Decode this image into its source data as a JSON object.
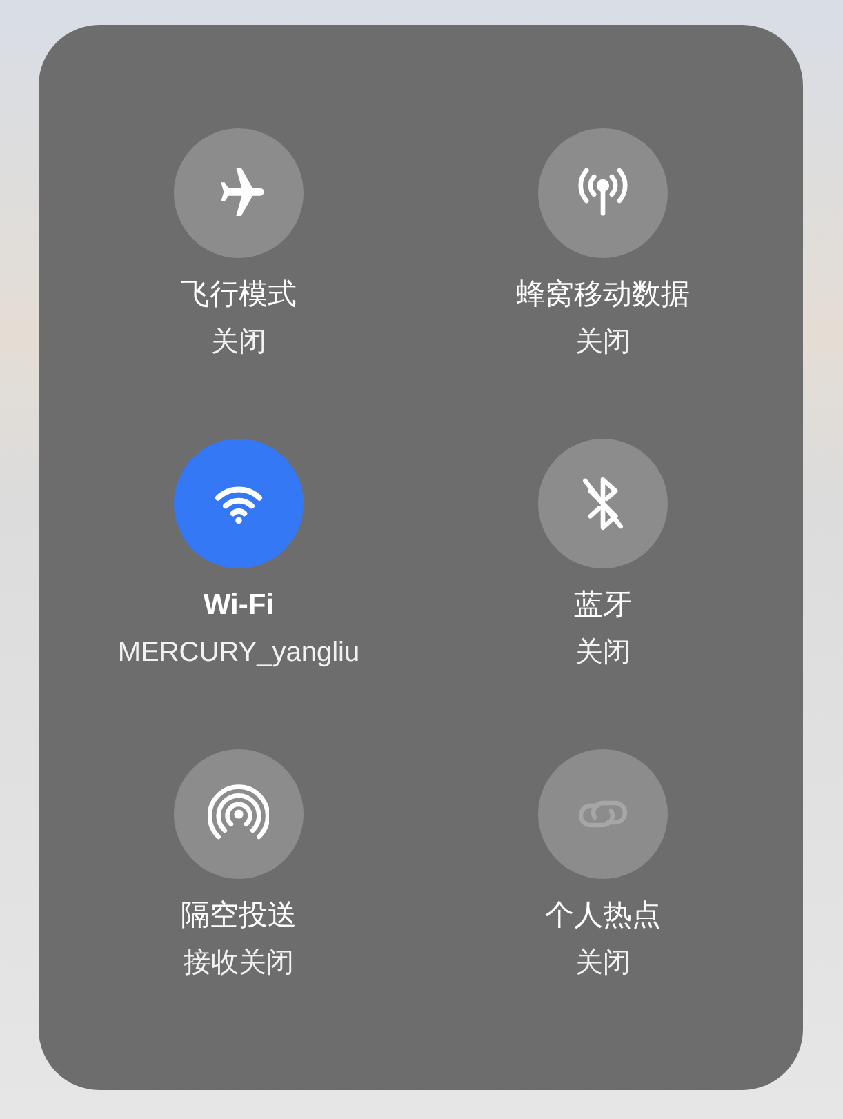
{
  "toggles": [
    {
      "kind": "airplane",
      "title": "飞行模式",
      "subtitle": "关闭",
      "on": false,
      "disabled": false
    },
    {
      "kind": "cellular",
      "title": "蜂窝移动数据",
      "subtitle": "关闭",
      "on": false,
      "disabled": false
    },
    {
      "kind": "wifi",
      "title": "Wi-Fi",
      "subtitle": "MERCURY_yangliu",
      "on": true,
      "disabled": false
    },
    {
      "kind": "bluetooth",
      "title": "蓝牙",
      "subtitle": "关闭",
      "on": false,
      "disabled": false
    },
    {
      "kind": "airdrop",
      "title": "隔空投送",
      "subtitle": "接收关闭",
      "on": false,
      "disabled": false
    },
    {
      "kind": "hotspot",
      "title": "个人热点",
      "subtitle": "关闭",
      "on": false,
      "disabled": true
    }
  ]
}
